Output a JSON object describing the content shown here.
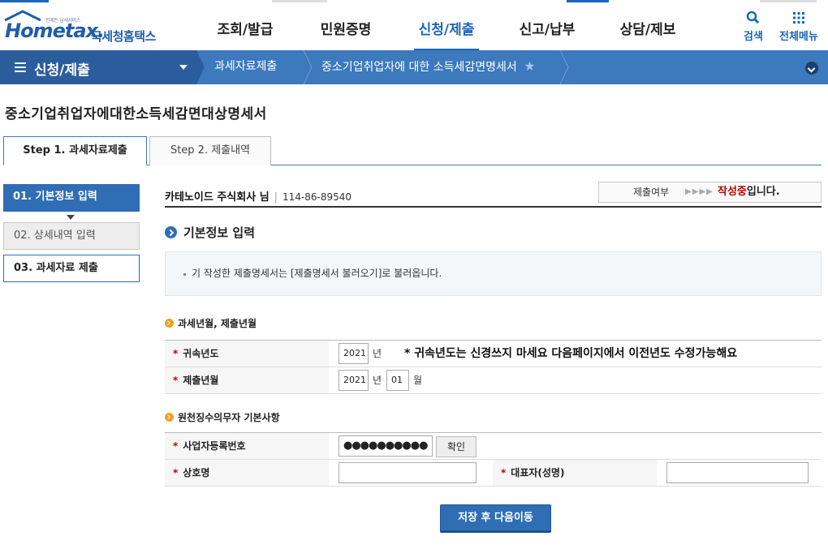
{
  "header": {
    "logo_sub": "언제든 납세서비스",
    "logo_name": "Hometax.",
    "logo_kr": "국세청홈택스",
    "nav": [
      "조회/발급",
      "민원증명",
      "신청/제출",
      "신고/납부",
      "상담/제보"
    ],
    "active_nav": "신청/제출",
    "search_label": "검색",
    "menu_label": "전체메뉴"
  },
  "breadcrumb": {
    "menu_label": "신청/제출",
    "items": [
      "과세자료제출",
      "중소기업취업자에 대한 소득세감면명세서"
    ]
  },
  "page": {
    "title": "중소기업취업자에대한소득세감면대상명세서",
    "tabs": [
      "Step 1. 과세자료제출",
      "Step 2. 제출내역"
    ]
  },
  "steps": [
    "01. 기본정보 입력",
    "02. 상세내역 입력",
    "03. 과세자료 제출"
  ],
  "main": {
    "company_name": "카테노이드 주식회사 님",
    "business_no": "114-86-89540",
    "status_label": "제출여부",
    "status_arrows": "▶▶▶▶",
    "status_value_red": "작성중",
    "status_value_suffix": "입니다.",
    "section_title": "기본정보 입력",
    "info_text": "기 작성한 제출명세서는 [제출명세서 불러오기]로 불러옵니다."
  },
  "form_period": {
    "title": "과세년월, 제출년월",
    "year_label": "귀속년도",
    "year_value": "2021",
    "year_unit": "년",
    "note": "* 귀속년도는 신경쓰지 마세요 다음페이지에서 이전년도 수정가능해요",
    "submit_label": "제출년월",
    "submit_year": "2021",
    "submit_year_unit": "년",
    "submit_month": "01",
    "submit_month_unit": "월"
  },
  "form_withholder": {
    "title": "원천징수의무자 기본사항",
    "bizno_label": "사업자등록번호",
    "bizno_value": "●●●●●●●●●●",
    "confirm_label": "확인",
    "company_label": "상호명",
    "rep_label": "대표자(성명)"
  },
  "actions": {
    "save_next": "저장 후 다음이동"
  },
  "colors": {
    "brand_blue": "#1a66b8",
    "bar_blue": "#3c79bd",
    "required_red": "#c00000",
    "accent_orange": "#f2a01e"
  },
  "star": "★",
  "required_mark": "*"
}
